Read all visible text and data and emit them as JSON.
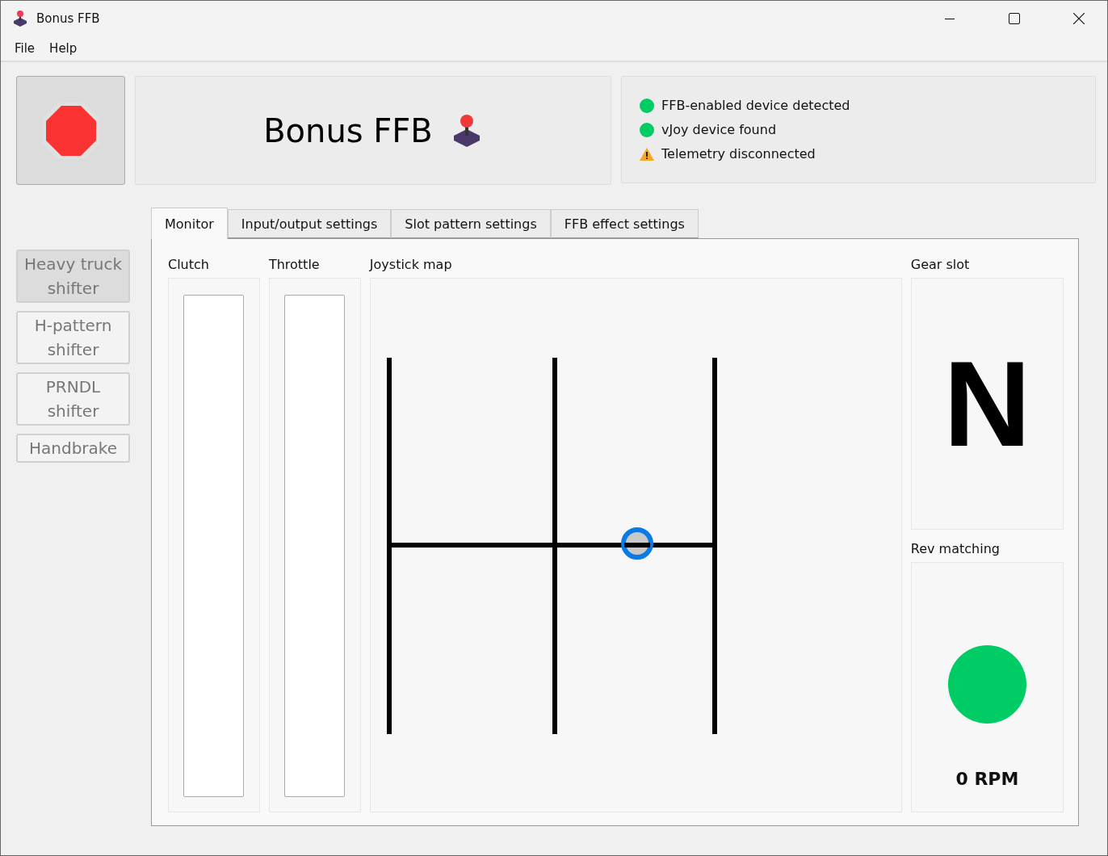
{
  "window": {
    "title": "Bonus FFB"
  },
  "menu": [
    {
      "label": "File"
    },
    {
      "label": "Help"
    }
  ],
  "header": {
    "title": "Bonus FFB",
    "stop_button": {
      "pressed": false
    }
  },
  "status": [
    {
      "kind": "ok",
      "text": "FFB-enabled device detected",
      "color": "#00cc66"
    },
    {
      "kind": "ok",
      "text": "vJoy device found",
      "color": "#00cc66"
    },
    {
      "kind": "warning",
      "text": "Telemetry disconnected",
      "color": "#f5a623"
    }
  ],
  "modes": [
    {
      "label": "Heavy truck\nshifter",
      "selected": true
    },
    {
      "label": "H-pattern\nshifter",
      "selected": false
    },
    {
      "label": "PRNDL\nshifter",
      "selected": false
    },
    {
      "label": "Handbrake",
      "selected": false
    }
  ],
  "tabs": [
    {
      "label": "Monitor",
      "selected": true
    },
    {
      "label": "Input/output settings",
      "selected": false
    },
    {
      "label": "Slot pattern settings",
      "selected": false
    },
    {
      "label": "FFB effect settings",
      "selected": false
    }
  ],
  "monitor": {
    "clutch": {
      "label": "Clutch"
    },
    "throttle": {
      "label": "Throttle"
    },
    "joystick_map": {
      "label": "Joystick map"
    },
    "gear_slot": {
      "label": "Gear slot",
      "value": "N"
    },
    "rev_matching": {
      "label": "Rev matching",
      "color": "#00cc66",
      "reading": "0 RPM"
    }
  }
}
